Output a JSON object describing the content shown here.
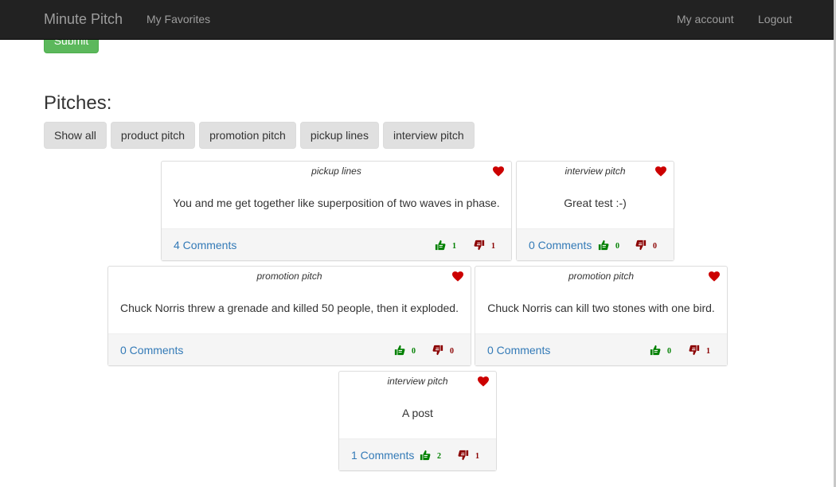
{
  "navbar": {
    "brand": "Minute Pitch",
    "favorites": "My Favorites",
    "account": "My account",
    "logout": "Logout"
  },
  "form": {
    "submit_label": "Submit"
  },
  "pitches": {
    "title": "Pitches:",
    "filters": [
      "Show all",
      "product pitch",
      "promotion pitch",
      "pickup lines",
      "interview pitch"
    ],
    "cards": [
      {
        "category": "pickup lines",
        "text": "You and me get together like superposition of two waves in phase.",
        "comments": "4 Comments",
        "upvotes": "1",
        "downvotes": "1"
      },
      {
        "category": "interview pitch",
        "text": "Great test :-)",
        "comments": "0 Comments",
        "upvotes": "0",
        "downvotes": "0"
      },
      {
        "category": "promotion pitch",
        "text": "Chuck Norris threw a grenade and killed 50 people, then it exploded.",
        "comments": "0 Comments",
        "upvotes": "0",
        "downvotes": "0"
      },
      {
        "category": "promotion pitch",
        "text": "Chuck Norris can kill two stones with one bird.",
        "comments": "0 Comments",
        "upvotes": "0",
        "downvotes": "1"
      },
      {
        "category": "interview pitch",
        "text": "A post",
        "comments": "1 Comments",
        "upvotes": "2",
        "downvotes": "1"
      }
    ]
  },
  "icons": {
    "heart": "heart-icon",
    "upvote": "thumbs-up-icon",
    "downvote": "thumbs-down-icon"
  },
  "colors": {
    "navbar_bg": "#222222",
    "navbar_text": "#9d9d9d",
    "submit_green": "#5cb85c",
    "link_blue": "#337ab7",
    "heart_red": "#cc0000",
    "upvote_green": "#008000",
    "downvote_red": "#8b0000"
  }
}
